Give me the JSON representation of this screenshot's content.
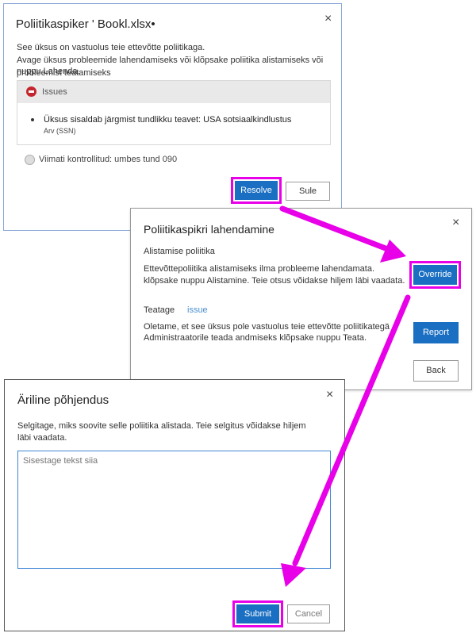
{
  "dialog1": {
    "title": "Poliitikaspiker ' Bookl.xlsx•",
    "line1": "See üksus on vastuolus teie ettevõtte poliitikaga.",
    "line2": "Avage üksus probleemide lahendamiseks või klõpsake poliitika alistamiseks või probleemist teatamiseks",
    "line3": "nuppu Lahenda.",
    "issues_header": "Issues",
    "issue_text": "Üksus sisaldab järgmist tundlikku teavet: USA sotsiaalkindlustus",
    "issue_sub": "Arv (SSN)",
    "last_checked": "Viimati kontrollitud: umbes tund 090",
    "resolve_label": "Resolve",
    "close_label": "Sule"
  },
  "dialog2": {
    "title": "Poliitikaspikri lahendamine",
    "override_heading": "Alistamise poliitika",
    "override_line1": "Ettevõttepoliitika alistamiseks ilma probleeme lahendamata.",
    "override_line2": "klõpsake nuppu Alistamine. Teie otsus võidakse hiljem läbi vaadata.",
    "override_button": "Override",
    "report_heading": "Teatage",
    "report_heading_extra": "issue",
    "report_line1": "Oletame, et see üksus pole vastuolus teie ettevõtte poliitikategä",
    "report_line2": "Administraatorile teada andmiseks klõpsake nuppu Teata.",
    "report_button": "Report",
    "back_button": "Back"
  },
  "dialog3": {
    "title": "Äriline põhjendus",
    "line1": "Selgitage, miks soovite selle poliitika alistada. Teie selgitus võidakse hiljem",
    "line2": "läbi vaadata.",
    "textarea_placeholder": "Sisestage tekst siia",
    "submit_label": "Submit",
    "cancel_label": "Cancel"
  },
  "close_glyph": "×",
  "colors": {
    "highlight": "#e800e8",
    "primary": "#1a6fc2",
    "error": "#c4262e"
  }
}
